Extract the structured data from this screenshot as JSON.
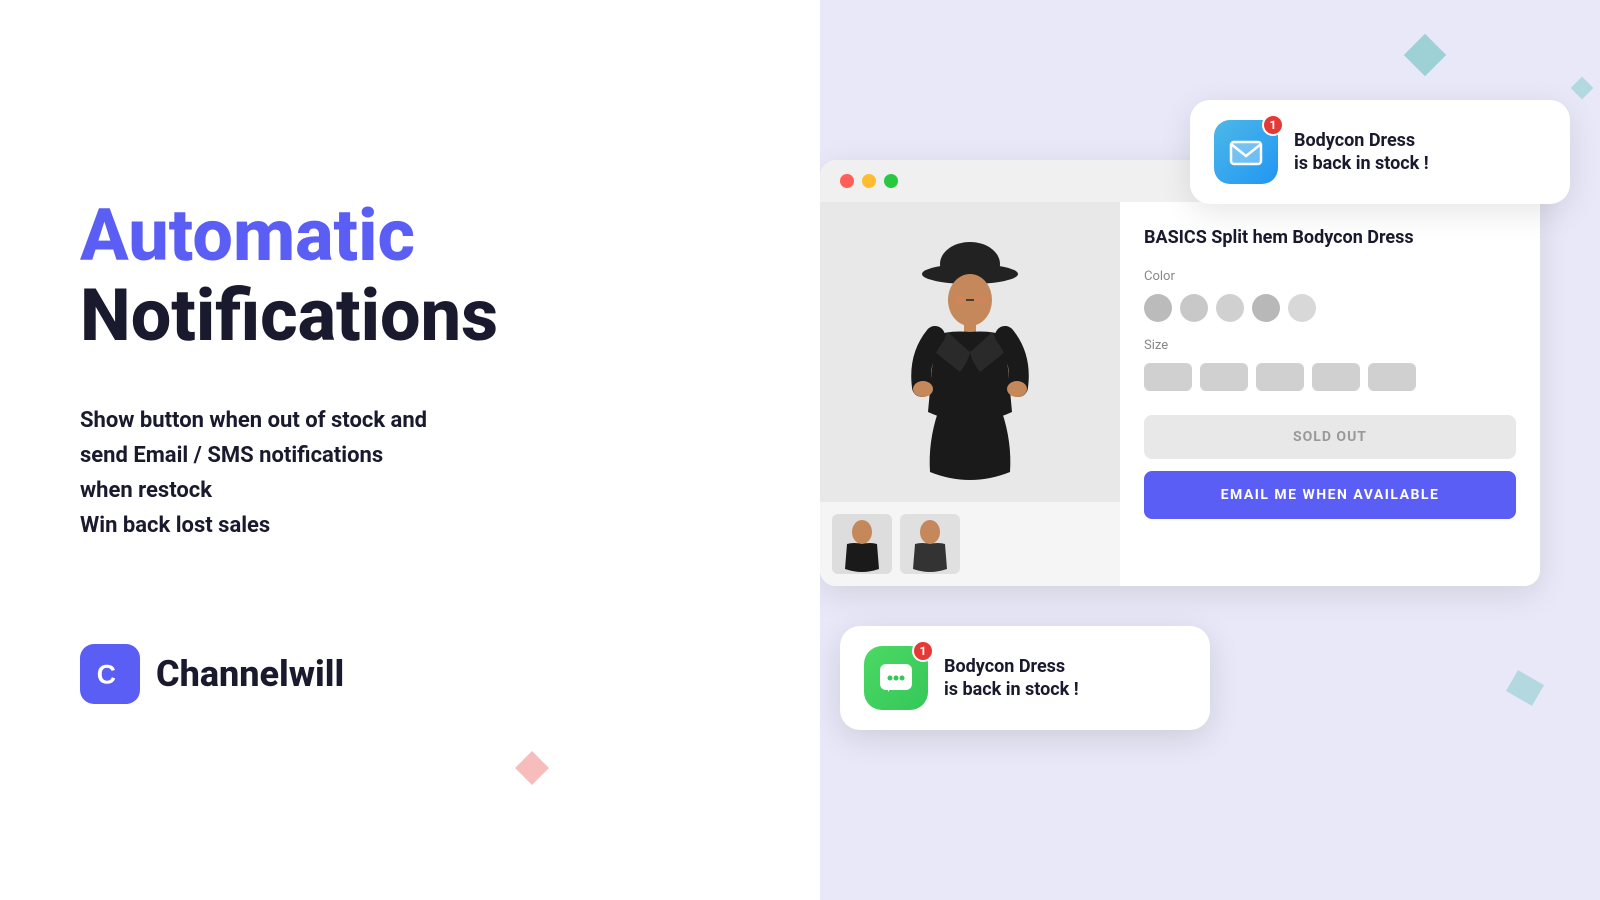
{
  "left": {
    "title_purple": "Automatic",
    "title_black": "Notifications",
    "description_line1": "Show button when out of stock and",
    "description_line2": "send Email / SMS notifications",
    "description_line3": "when restock",
    "description_line4": "Win back lost sales",
    "logo_text": "Channelwill"
  },
  "right": {
    "email_notification": {
      "badge": "1",
      "text_line1": "Bodycon Dress",
      "text_line2": "is back in stock !"
    },
    "browser": {
      "product_title": "BASICS Split hem Bodycon Dress",
      "color_label": "Color",
      "size_label": "Size",
      "sold_out_label": "SOLD OUT",
      "email_btn_label": "EMAIL ME WHEN AVAILABLE"
    },
    "sms_notification": {
      "badge": "1",
      "text_line1": "Bodycon Dress",
      "text_line2": "is back in stock !"
    }
  },
  "colors": {
    "purple": "#5b5ef4",
    "black": "#1a1a2e",
    "right_bg": "#e8e8f8",
    "sold_out_bg": "#e8e8e8",
    "email_btn_bg": "#5b5ef4"
  }
}
